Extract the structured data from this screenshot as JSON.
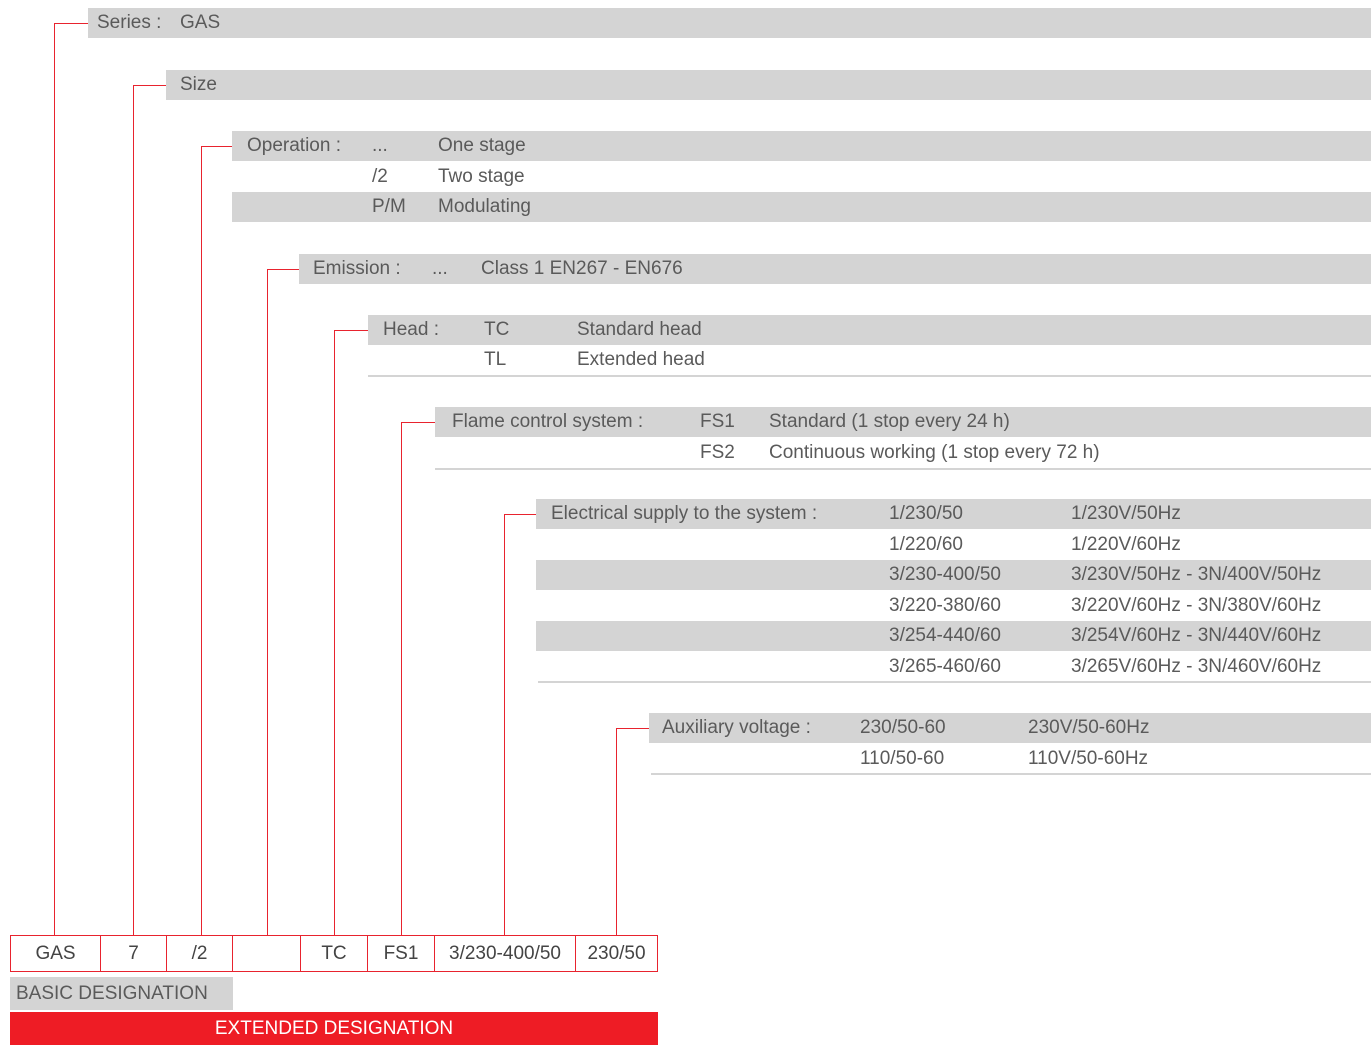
{
  "series": {
    "label": "Series :",
    "value": "GAS"
  },
  "size": {
    "label": "Size"
  },
  "operation": {
    "label": "Operation :",
    "rows": [
      {
        "code": "...",
        "desc": "One stage"
      },
      {
        "code": "/2",
        "desc": "Two stage"
      },
      {
        "code": "P/M",
        "desc": "Modulating"
      }
    ]
  },
  "emission": {
    "label": "Emission :",
    "code": "...",
    "desc": "Class 1  EN267 - EN676"
  },
  "head": {
    "label": "Head :",
    "rows": [
      {
        "code": "TC",
        "desc": "Standard head"
      },
      {
        "code": "TL",
        "desc": "Extended head"
      }
    ]
  },
  "flame": {
    "label": "Flame control system :",
    "rows": [
      {
        "code": "FS1",
        "desc": "Standard (1 stop every 24 h)"
      },
      {
        "code": "FS2",
        "desc": "Continuous working (1 stop every 72 h)"
      }
    ]
  },
  "supply": {
    "label": "Electrical supply to the system :",
    "rows": [
      {
        "code": "1/230/50",
        "desc": "1/230V/50Hz"
      },
      {
        "code": "1/220/60",
        "desc": "1/220V/60Hz"
      },
      {
        "code": "3/230-400/50",
        "desc": "3/230V/50Hz - 3N/400V/50Hz"
      },
      {
        "code": "3/220-380/60",
        "desc": "3/220V/60Hz  - 3N/380V/60Hz"
      },
      {
        "code": "3/254-440/60",
        "desc": "3/254V/60Hz - 3N/440V/60Hz"
      },
      {
        "code": "3/265-460/60",
        "desc": "3/265V/60Hz - 3N/460V/60Hz"
      }
    ]
  },
  "auxiliary": {
    "label": "Auxiliary voltage :",
    "rows": [
      {
        "code": "230/50-60",
        "desc": "230V/50-60Hz"
      },
      {
        "code": "110/50-60",
        "desc": "110V/50-60Hz"
      }
    ]
  },
  "designation_boxes": [
    "GAS",
    "7",
    "/2",
    "",
    "TC",
    "FS1",
    "3/230-400/50",
    "230/50"
  ],
  "basic_label": "BASIC DESIGNATION",
  "extended_label": "EXTENDED DESIGNATION",
  "colors": {
    "accent": "#ee1c25",
    "band": "#d4d4d4",
    "text": "#5a5a5a"
  }
}
